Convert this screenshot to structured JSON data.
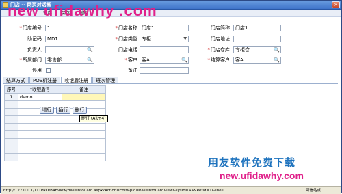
{
  "window": {
    "title": "门店 -- 网页对话框"
  },
  "toolbar": {
    "items": [
      "暂存",
      "保存",
      "删除"
    ]
  },
  "watermark_top": "new ufidawhy .com",
  "form": {
    "store_code": {
      "label": "门店编号",
      "value": "1"
    },
    "store_name": {
      "label": "门店名称",
      "value": "门店1"
    },
    "store_short": {
      "label": "门店简称",
      "value": "门店1"
    },
    "mnemonic": {
      "label": "助记码",
      "value": "MD1"
    },
    "store_type": {
      "label": "门店类型",
      "value": "专柜"
    },
    "store_address": {
      "label": "门店地址",
      "value": ""
    },
    "manager": {
      "label": "负责人",
      "value": ""
    },
    "store_phone": {
      "label": "门店电话",
      "value": ""
    },
    "store_warehouse": {
      "label": "门店仓库",
      "value": "专柜仓"
    },
    "department": {
      "label": "所属部门",
      "value": "零售部"
    },
    "customer": {
      "label": "客户",
      "value": "客A"
    },
    "settle_customer": {
      "label": "结算客户",
      "value": "客A"
    },
    "disabled": {
      "label": "停用"
    },
    "remark": {
      "label": "备注",
      "value": ""
    }
  },
  "tabs": [
    "结算方式",
    "POS机注册",
    "收银盾注册",
    "班次管理"
  ],
  "grid": {
    "headers": [
      "序号",
      "收银盾号",
      "备注"
    ],
    "rows": [
      {
        "no": "1",
        "code": "demo",
        "remark": ""
      }
    ]
  },
  "row_buttons": {
    "add": "增行",
    "insert": "插行",
    "delete": "删行"
  },
  "tooltip": "删行 (Alt+4)",
  "watermark_bottom": {
    "chinese": "用友软件免费下载",
    "url": "new.ufidawhy.com"
  },
  "status": {
    "url": "http://127.0.0.1/TTTPRO/BAFView/BaseInfoCard.aspx?Action=Edit&pId=baseInfoCardView&sysId=AA&RefId=1&shell",
    "zone": "可信站点"
  }
}
